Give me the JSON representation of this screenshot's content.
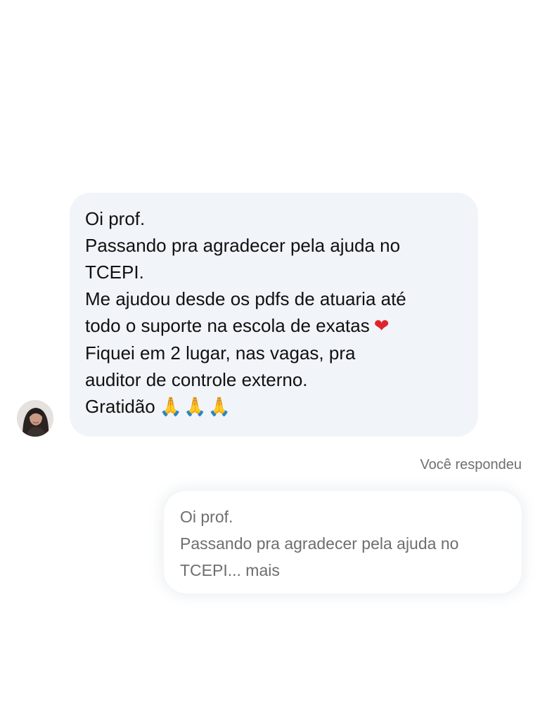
{
  "incoming": {
    "lines": [
      "Oi prof.",
      "Passando pra agradecer pela ajuda no",
      "TCEPI.",
      "Me ajudou desde os pdfs de atuaria até",
      "todo o suporte na escola de exatas",
      "Fiquei em 2 lugar, nas vagas, pra",
      "auditor de controle externo.",
      "Gratidão"
    ],
    "heart_emoji": "❤",
    "pray_emojis": "🙏🙏🙏"
  },
  "replied_label": "Você respondeu",
  "reply_preview": {
    "lines": [
      "Oi prof.",
      "Passando pra agradecer pela ajuda no",
      "TCEPI..."
    ],
    "more_label": "mais"
  },
  "icons": {
    "avatar": "profile-photo",
    "heart": "red-heart-emoji",
    "pray": "folded-hands-emoji"
  },
  "colors": {
    "incoming_bubble": "#f1f4f8",
    "message_text": "#111111",
    "muted_text": "#6e6e6e",
    "heart": "#e0242b"
  }
}
